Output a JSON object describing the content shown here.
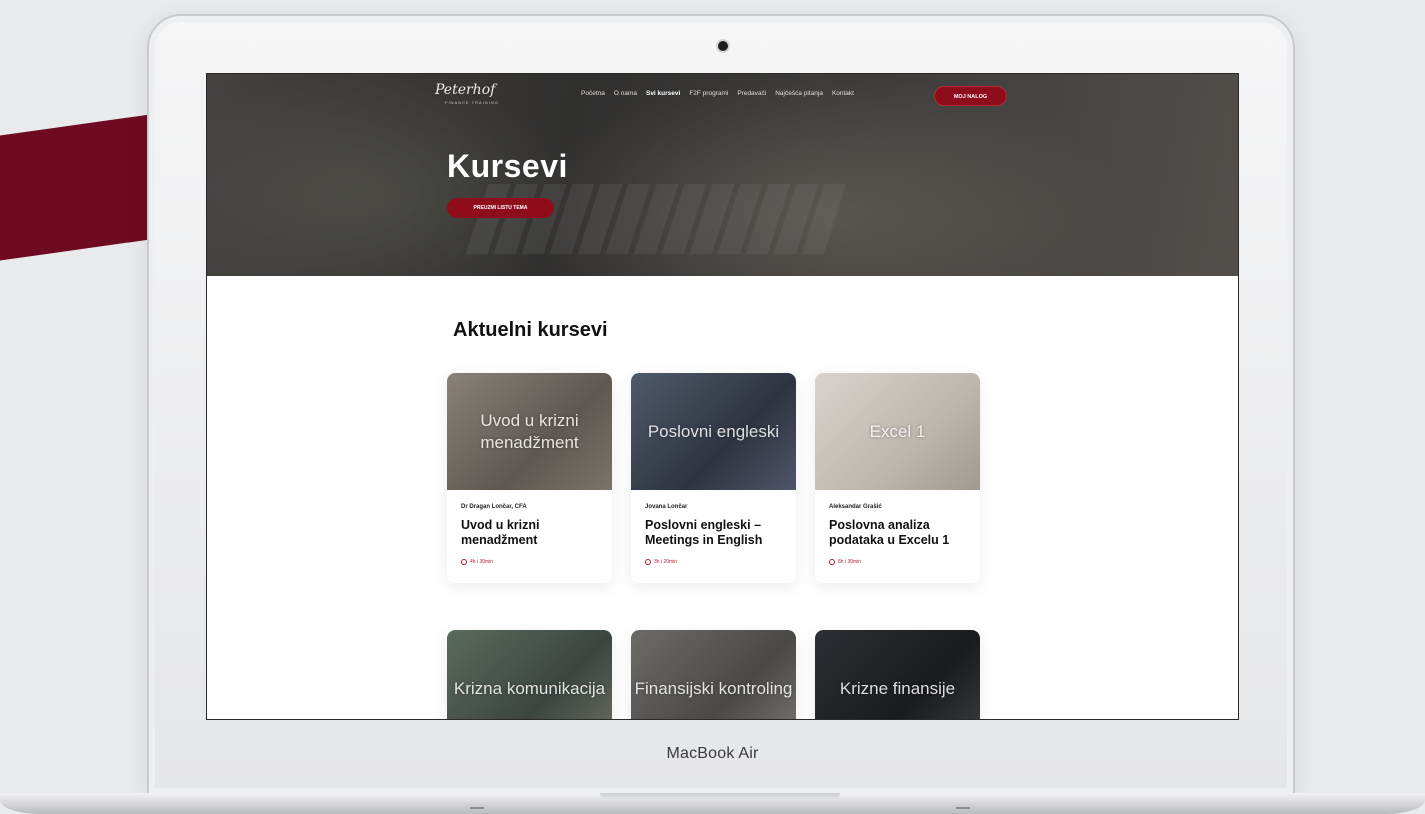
{
  "device": {
    "label": "MacBook Air"
  },
  "site": {
    "logo": "Peterhof",
    "logo_sub": "FINANCE TRAINING",
    "nav": [
      {
        "label": "Početna",
        "active": false
      },
      {
        "label": "O nama",
        "active": false
      },
      {
        "label": "Svi kursevi",
        "active": true
      },
      {
        "label": "F2F programi",
        "active": false
      },
      {
        "label": "Predavači",
        "active": false
      },
      {
        "label": "Najčešća pitanja",
        "active": false
      },
      {
        "label": "Kontakt",
        "active": false
      }
    ],
    "account_button": "MOJ NALOG",
    "accent_color": "#8f0d1b"
  },
  "hero": {
    "title": "Kursevi",
    "button": "PREUZMI LISTU TEMA"
  },
  "section": {
    "title": "Aktuelni kursevi"
  },
  "courses": [
    {
      "image_label": "Uvod u krizni menadžment",
      "author": "Dr Dragan Lončar, CFA",
      "title": "Uvod u krizni menadžment",
      "duration": "4h i 30min",
      "icon": "clock-icon"
    },
    {
      "image_label": "Poslovni engleski",
      "author": "Jovana Lončar",
      "title": "Poslovni engleski – Meetings in English",
      "duration": "3h i 20min",
      "icon": "clock-icon"
    },
    {
      "image_label": "Excel 1",
      "author": "Aleksandar Grašić",
      "title": "Poslovna analiza podataka u Excelu 1",
      "duration": "6h i 30min",
      "icon": "clock-icon"
    },
    {
      "image_label": "Krizna komunikacija"
    },
    {
      "image_label": "Finansijski kontroling"
    },
    {
      "image_label": "Krizne finansije"
    }
  ]
}
